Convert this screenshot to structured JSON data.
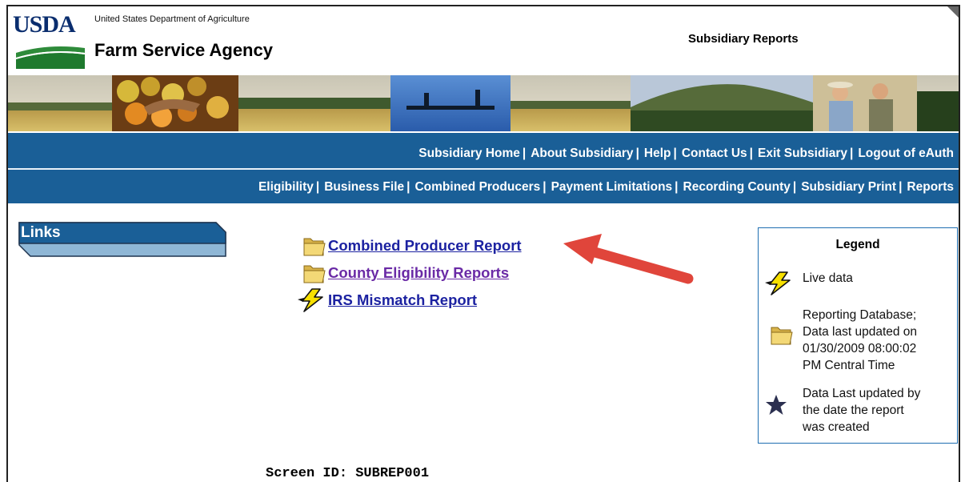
{
  "header": {
    "logo_text": "USDA",
    "department": "United States Department of Agriculture",
    "agency": "Farm Service Agency",
    "page_heading": "Subsidiary Reports"
  },
  "nav_primary": [
    {
      "label": "Subsidiary Home"
    },
    {
      "label": "About Subsidiary"
    },
    {
      "label": "Help"
    },
    {
      "label": "Contact Us"
    },
    {
      "label": "Exit Subsidiary"
    },
    {
      "label": "Logout of eAuth"
    }
  ],
  "nav_secondary": [
    {
      "label": "Eligibility"
    },
    {
      "label": "Business File"
    },
    {
      "label": "Combined Producers"
    },
    {
      "label": "Payment Limitations"
    },
    {
      "label": "Recording County"
    },
    {
      "label": "Subsidiary Print"
    },
    {
      "label": "Reports"
    }
  ],
  "nav_separator": "|",
  "sidebar": {
    "title": "Links"
  },
  "reports": [
    {
      "label": "Combined Producer Report",
      "icon": "folder-icon",
      "state": "unvisited"
    },
    {
      "label": "County Eligibility Reports",
      "icon": "folder-icon",
      "state": "visited"
    },
    {
      "label": "IRS Mismatch Report",
      "icon": "lightning-icon",
      "state": "unvisited"
    }
  ],
  "legend": {
    "title": "Legend",
    "items": [
      {
        "icon": "lightning-icon",
        "lines": [
          "Live data"
        ]
      },
      {
        "icon": "folder-icon",
        "lines": [
          "Reporting Database;",
          "Data last updated on",
          "01/30/2009 08:00:02",
          "PM Central Time"
        ]
      },
      {
        "icon": "star-icon",
        "lines": [
          "Data Last updated by",
          "the date the report",
          "was created"
        ]
      }
    ]
  },
  "footer": {
    "screen_id": "Screen ID: SUBREP001"
  },
  "colors": {
    "nav_bg": "#1a5f97",
    "link": "#1c22a1",
    "visited_link": "#6a2aa6",
    "annotation_arrow": "#e0453b",
    "legend_border": "#1f6fb2"
  }
}
